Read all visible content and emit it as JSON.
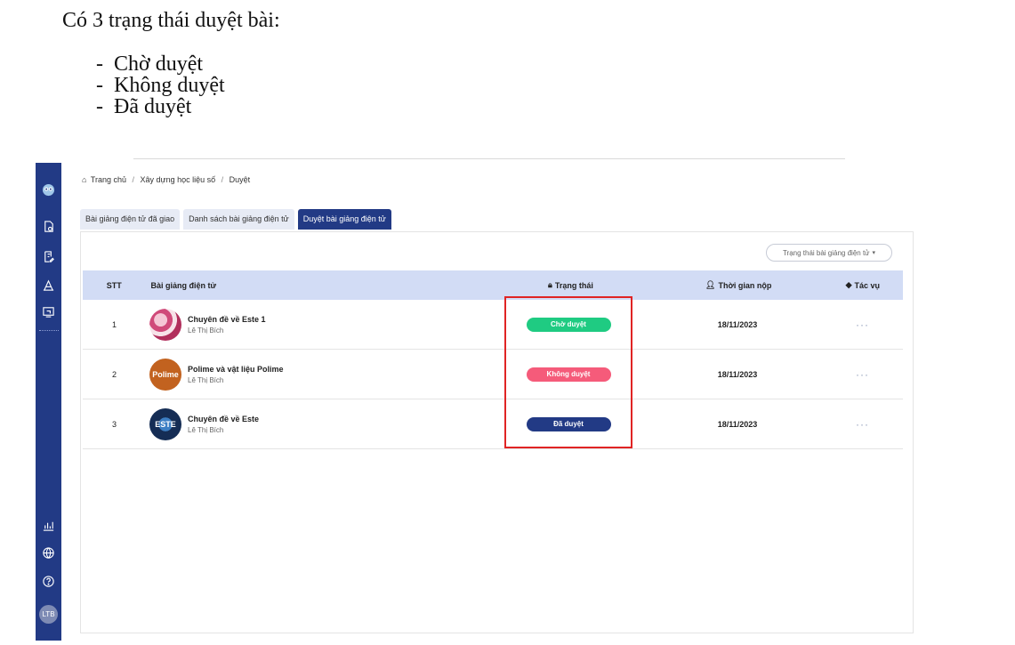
{
  "doc": {
    "heading": "Có 3 trạng thái duyệt bài:",
    "list": [
      {
        "dash": "-",
        "text": "Chờ duyệt"
      },
      {
        "dash": "-",
        "text": "Không duyệt"
      },
      {
        "dash": "-",
        "text": "Đã duyệt"
      }
    ]
  },
  "sidebar": {
    "icons": [
      "owl-logo-icon",
      "document-icon",
      "edit-document-icon",
      "tools-icon",
      "presentation-icon",
      "chart-icon",
      "globe-icon",
      "help-icon"
    ],
    "avatar": "LTB"
  },
  "breadcrumb": {
    "home": "Trang chủ",
    "sep": "/",
    "section": "Xây dựng học liệu số",
    "current": "Duyệt"
  },
  "tabs": [
    {
      "label": "Bài giảng điện tử đã giao"
    },
    {
      "label": "Danh sách bài giảng điện tử"
    },
    {
      "label": "Duyệt bài giảng điện tử"
    }
  ],
  "filter": {
    "label": "Trạng thái bài giảng điện tử",
    "caret": "▾"
  },
  "table": {
    "headers": {
      "stt": "STT",
      "name": "Bài giảng điện tử",
      "status": "Trạng thái",
      "time": "Thời gian nộp",
      "action": "Tác vụ"
    },
    "rows": [
      {
        "stt": "1",
        "title": "Chuyên đề về Este 1",
        "author": "Lê Thị Bích",
        "status": "Chờ duyệt",
        "time": "18/11/2023",
        "thumb": ""
      },
      {
        "stt": "2",
        "title": "Polime và vật liệu Polime",
        "author": "Lê Thị Bích",
        "status": "Không duyệt",
        "time": "18/11/2023",
        "thumb": "Polime"
      },
      {
        "stt": "3",
        "title": "Chuyên đề về Este",
        "author": "Lê Thị Bích",
        "status": "Đã duyệt",
        "time": "18/11/2023",
        "thumb": "ESTE"
      }
    ],
    "more": "···"
  },
  "colors": {
    "sidebar": "#223a85",
    "header_bg": "#d2dcf5",
    "pending": "#1fcb82",
    "rejected": "#f55b7a",
    "approved": "#223a85",
    "highlight": "#e02424"
  }
}
